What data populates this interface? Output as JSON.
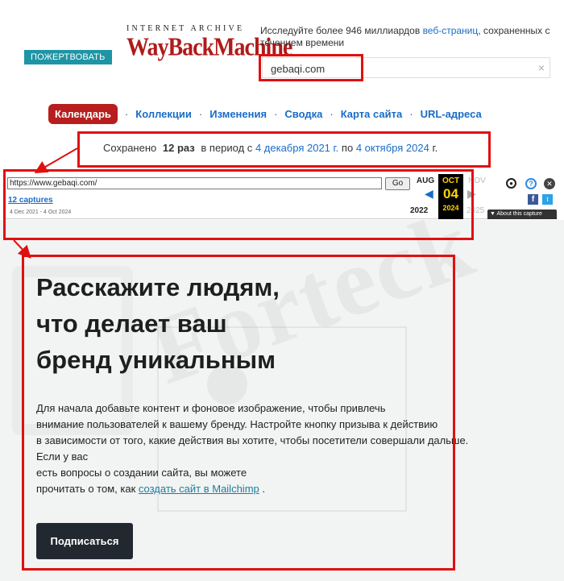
{
  "header": {
    "donate_label": "ПОЖЕРТВОВАТЬ",
    "logo_top": "INTERNET ARCHIVE",
    "logo_main": "WayBackMachine",
    "intro_before": "Исследуйте более 946 миллиардов ",
    "intro_link": "веб-страниц",
    "intro_after": ", сохраненных с течением времени",
    "search_value": "gebaqi.com",
    "clear_glyph": "×"
  },
  "nav": {
    "active": "Календарь",
    "items": [
      "Коллекции",
      "Изменения",
      "Сводка",
      "Карта сайта",
      "URL-адреса"
    ],
    "sep": "·"
  },
  "saved": {
    "prefix": "Сохранено",
    "count": "12 раз",
    "mid": "в период с",
    "from": "4 декабря 2021 г.",
    "to_word": "по",
    "to": "4 октября 2024",
    "suffix": "г."
  },
  "toolbar": {
    "url": "https://www.gebaqi.com/",
    "go": "Go",
    "captures": "12 captures",
    "range": "4 Dec 2021 - 4 Oct 2024",
    "prev_month": "AUG",
    "cur_month": "OCT",
    "cur_day": "04",
    "cur_year": "2024",
    "next_month": "NOV",
    "prev_year": "2022",
    "next_year": "2025",
    "about": "▼ About this capture",
    "fb": "f",
    "tw": "t",
    "help": "?",
    "close": "✕",
    "user": "●"
  },
  "site": {
    "headline": [
      "Расскажите людям,",
      "что делает ваш",
      "бренд уникальным"
    ],
    "lines": [
      "Для начала добавьте контент и фоновое изображение, чтобы привлечь",
      "внимание пользователей к вашему бренду. Настройте кнопку призыва к действию",
      "в зависимости от того, какие действия вы хотите, чтобы посетители совершали дальше.",
      "Если у вас",
      "есть вопросы о создании сайта, вы можете"
    ],
    "last_before": "прочитать о том, как ",
    "last_link": "создать сайт в Mailchimp",
    "last_after": " .",
    "button": "Подписаться"
  },
  "watermark": "Forteck",
  "colors": {
    "highlight": "#e01010",
    "donate": "#1e95a5",
    "logo": "#b01a1a",
    "link": "#1a6cc6"
  }
}
